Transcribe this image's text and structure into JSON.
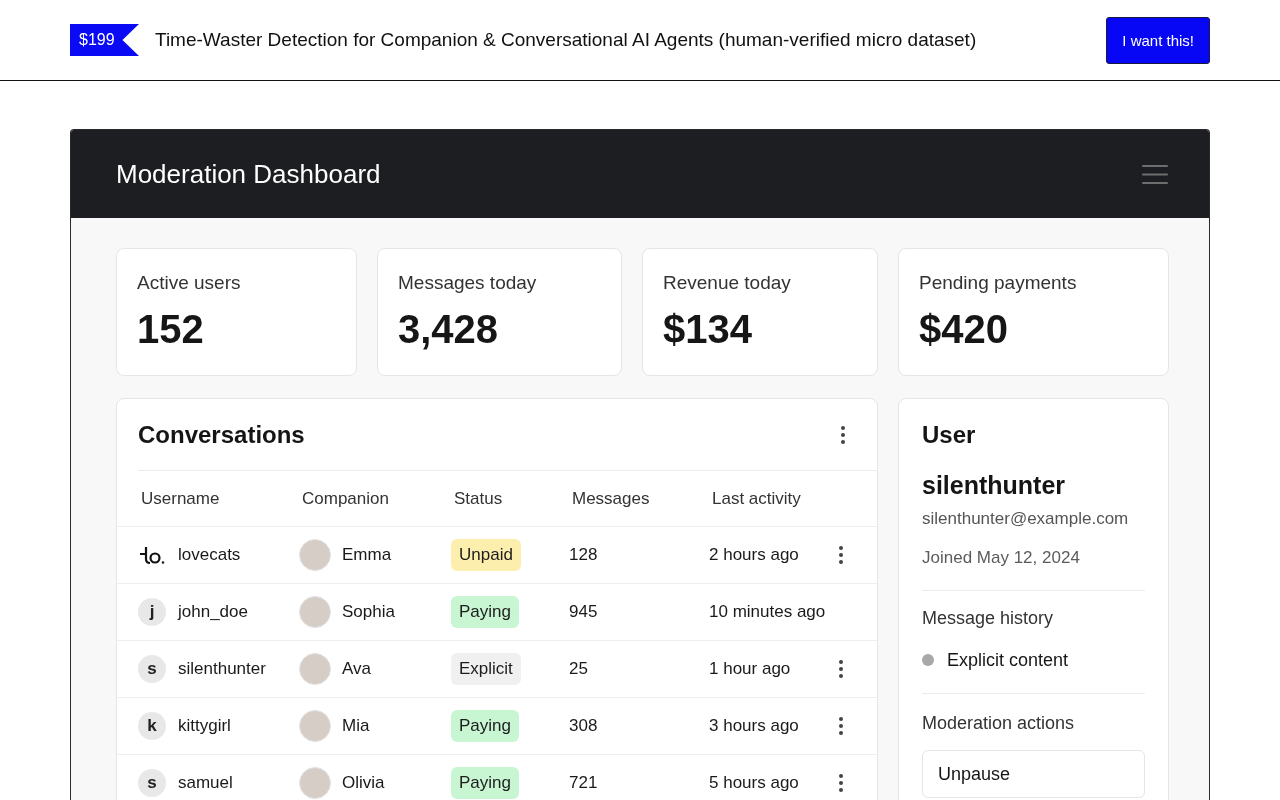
{
  "banner": {
    "price": "$199",
    "title": "Time-Waster Detection for Companion & Conversational AI Agents (human-verified micro dataset)",
    "button": "I want this!"
  },
  "dashboard": {
    "title": "Moderation Dashboard"
  },
  "stats": [
    {
      "label": "Active users",
      "value": "152"
    },
    {
      "label": "Messages today",
      "value": "3,428"
    },
    {
      "label": "Revenue today",
      "value": "$134"
    },
    {
      "label": "Pending payments",
      "value": "$420"
    }
  ],
  "conversations": {
    "title": "Conversations",
    "columns": [
      "Username",
      "Companion",
      "Status",
      "Messages",
      "Last activity"
    ],
    "rows": [
      {
        "avatar": {
          "kind": "logo"
        },
        "username": "lovecats",
        "companion": "Emma",
        "status": {
          "label": "Unpaid",
          "color": "#fcefad"
        },
        "messages": "128",
        "last_activity": "2 hours ago",
        "menu": true
      },
      {
        "avatar": {
          "kind": "initial",
          "letter": "j"
        },
        "username": "john_doe",
        "companion": "Sophia",
        "status": {
          "label": "Paying",
          "color": "#c8f5d2"
        },
        "messages": "945",
        "last_activity": "10 minutes ago",
        "menu": false
      },
      {
        "avatar": {
          "kind": "initial",
          "letter": "s"
        },
        "username": "silenthunter",
        "companion": "Ava",
        "status": {
          "label": "Explicit",
          "color": "#f0f0f0"
        },
        "messages": "25",
        "last_activity": "1 hour ago",
        "menu": true
      },
      {
        "avatar": {
          "kind": "initial",
          "letter": "k"
        },
        "username": "kittygirl",
        "companion": "Mia",
        "status": {
          "label": "Paying",
          "color": "#c8f5d2"
        },
        "messages": "308",
        "last_activity": "3 hours ago",
        "menu": true
      },
      {
        "avatar": {
          "kind": "initial",
          "letter": "s"
        },
        "username": "samuel",
        "companion": "Olivia",
        "status": {
          "label": "Paying",
          "color": "#c8f5d2"
        },
        "messages": "721",
        "last_activity": "5 hours ago",
        "menu": true
      }
    ]
  },
  "user": {
    "title": "User",
    "username": "silenthunter",
    "email": "silenthunter@example.com",
    "joined": "Joined May 12, 2024",
    "history_title": "Message history",
    "history": [
      {
        "label": "Explicit content",
        "color": "#a8a8a8"
      }
    ],
    "actions_title": "Moderation actions",
    "actions": [
      "Unpause"
    ]
  }
}
